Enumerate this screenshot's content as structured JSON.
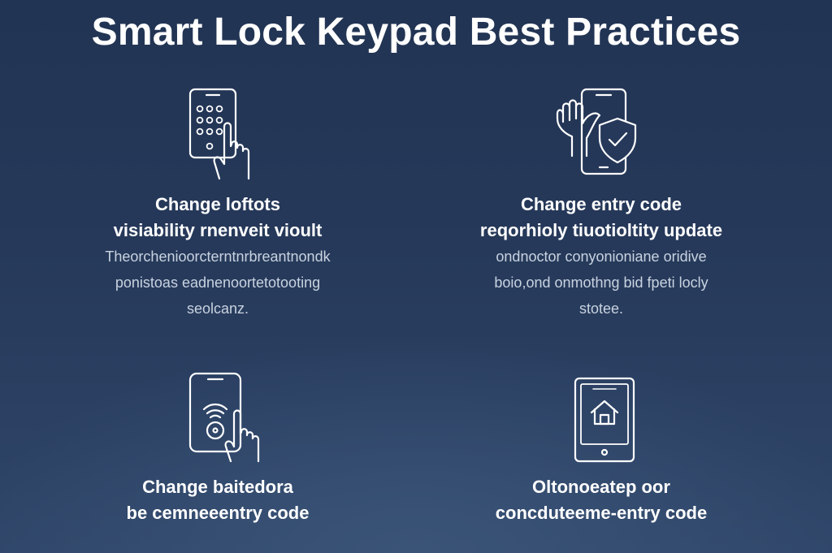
{
  "title": "Smart Lock Keypad Best Practices",
  "cards": [
    {
      "icon": "phone-keypad-hand-icon",
      "heading": [
        "Change loftots",
        "visiability rnenveit vioult"
      ],
      "body": [
        "Theorchenioorcterntnrbreantnondk",
        "ponistoas eadnenoortetotooting",
        "seolcanz."
      ]
    },
    {
      "icon": "phone-hand-shield-check-icon",
      "heading": [
        "Change entry code",
        "reqorhioly tiuotioltity update"
      ],
      "body": [
        "ondnoctor conyonioniane oridive",
        "boio,ond onmothng bid fpeti locly",
        "stotee."
      ]
    },
    {
      "icon": "phone-wifi-hand-icon",
      "heading": [
        "Change baitedora",
        "be cemneeentry code"
      ],
      "body": []
    },
    {
      "icon": "tablet-home-icon",
      "heading": [
        "Oltonoeatep oor",
        "concduteeme-entry code"
      ],
      "body": []
    }
  ]
}
